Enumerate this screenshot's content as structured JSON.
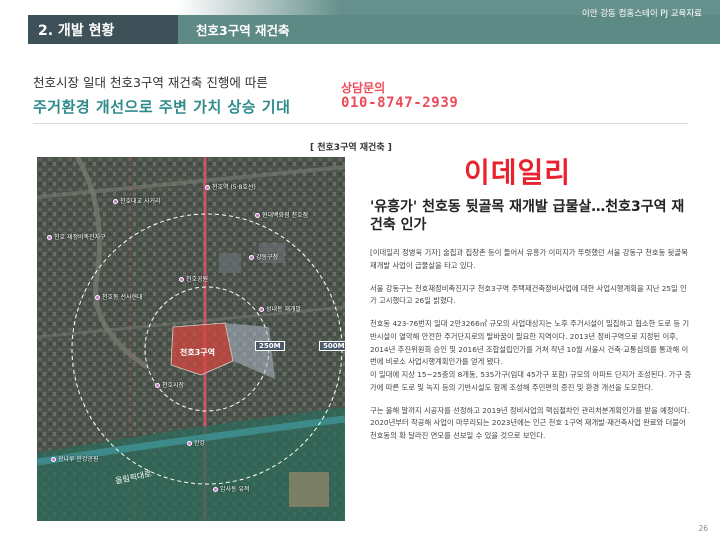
{
  "header": {
    "section": "2. 개발 현황",
    "subsection": "천호3구역 재건축",
    "org": "이안 강동 컴홈스테이 PJ 교육자료"
  },
  "intro": {
    "line": "천호시장 일대 천호3구역 재건축 진행에 따른",
    "headline": "주거환경 개선으로 주변 가치 상승 기대"
  },
  "contact": {
    "label": "상담문의",
    "phone": "010-8747-2939"
  },
  "map": {
    "caption": "[ 천호3구역 재건축 ]",
    "zone_label": "천호3구역",
    "ring_labels": [
      "250M",
      "500M"
    ],
    "road_label": "올림픽대로",
    "places": [
      "천호대교 사거리",
      "천호역 (5·8호선)",
      "현대백화점 천호점",
      "강동구청",
      "천호공원",
      "천호 재정비촉진지구",
      "천호동 선사현대",
      "성내동 재개발",
      "천호시장",
      "한강",
      "광나루 한강공원",
      "암사동 유적"
    ]
  },
  "article": {
    "brand": "이데일리",
    "title": "'유흥가' 천호동 뒷골목 재개발 급물살…천호3구역 재건축 인가",
    "paragraphs": [
      "[이데일리 정병욱 기자] 술집과 집창촌 등이 들어서 유흥가 이미지가 뚜렷했던 서울 강동구 천호동 뒷골목 재개발 사업이 급물살을 타고 있다.",
      "서울 강동구는 천호재정비촉진지구 천호3구역 주택재건축정비사업에 대한 사업시행계획을 지난 25일 인가 고시했다고 26일 밝혔다.",
      "천호동 423-76번지 일대 2만3266㎡ 규모의 사업대상지는 노후 주거시설이 밀집하고 협소한 도로 등 기반시설이 열악해 안전한 주거단지로의 탈바꿈이 필요한 지역이다. 2013년 정비구역으로 지정된 이후, 2014년 추진위원회 승인 및 2016년 조합설립인가를 거쳐 작년 10월 서울시 건축·교통심의를 통과해 이번에 비로소 사업시행계획인가를 얻게 됐다.",
      "이 일대에 지상 15~25층의 8개동, 535가구(임대 45가구 포함) 규모의 아파트 단지가 조성된다. 가구 증가에 따른 도로 및 녹지 등의 기반시설도 함께 조성해 주민편의 증진 및 환경 개선을 도모한다.",
      "구는 올해 말까지 시공자를 선정하고 2019년 정비사업의 핵심절차인 관리처분계획인가를 받을 예정이다. 2020년부터 착공해 사업이 마무리되는 2023년에는 인근 천호 1구역 재개발·재건축사업 완료와 더불어 천호동의 확 달라진 면모를 선보일 수 있을 것으로 보인다."
    ]
  },
  "page_number": "26",
  "colors": {
    "header_dark": "#3f5158",
    "header_green": "#5e8a86",
    "headline_teal": "#2e8b8a",
    "accent_red": "#e8232f",
    "contact_red": "#ee4b5a"
  }
}
